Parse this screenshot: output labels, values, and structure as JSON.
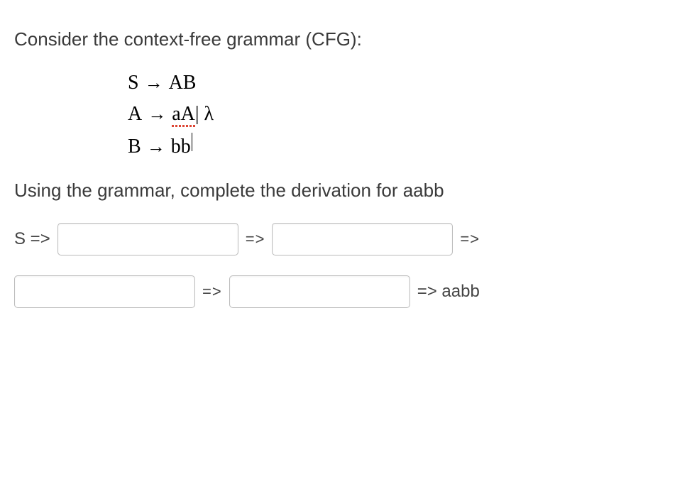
{
  "intro": "Consider the context-free grammar (CFG):",
  "grammar": {
    "rule1": {
      "lhs": "S",
      "rhs": "AB"
    },
    "rule2": {
      "lhs": "A",
      "rhs_part1": "aA",
      "rhs_part2": " | λ"
    },
    "rule3": {
      "lhs": "B",
      "rhs": "bb"
    }
  },
  "instruction": "Using the grammar, complete the derivation for aabb",
  "derivation": {
    "start": "S =>",
    "arrow": "=>",
    "final": "=> aabb"
  }
}
